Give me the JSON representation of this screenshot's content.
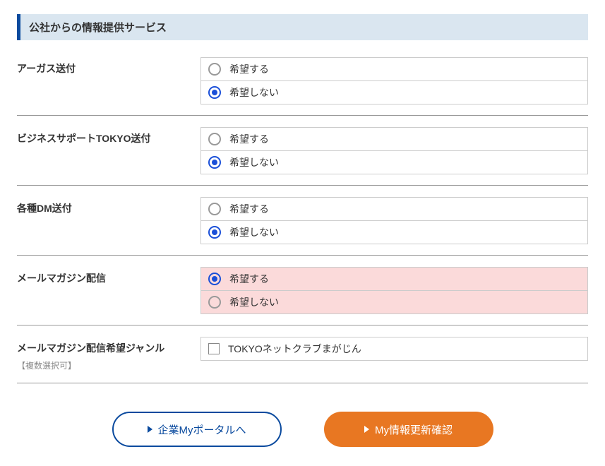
{
  "section_title": "公社からの情報提供サービス",
  "fields": {
    "argus": {
      "label": "アーガス送付",
      "opt1": "希望する",
      "opt2": "希望しない",
      "selected": 1
    },
    "bizsupport": {
      "label": "ビジネスサポートTOKYO送付",
      "opt1": "希望する",
      "opt2": "希望しない",
      "selected": 1
    },
    "dm": {
      "label": "各種DM送付",
      "opt1": "希望する",
      "opt2": "希望しない",
      "selected": 1
    },
    "mailmag": {
      "label": "メールマガジン配信",
      "opt1": "希望する",
      "opt2": "希望しない",
      "selected": 0,
      "highlight": true
    },
    "genre": {
      "label": "メールマガジン配信希望ジャンル",
      "sublabel": "【複数選択可】",
      "opt1": "TOKYOネットクラブまがじん"
    }
  },
  "buttons": {
    "portal": "企業Myポータルへ",
    "confirm": "My情報更新確認"
  }
}
